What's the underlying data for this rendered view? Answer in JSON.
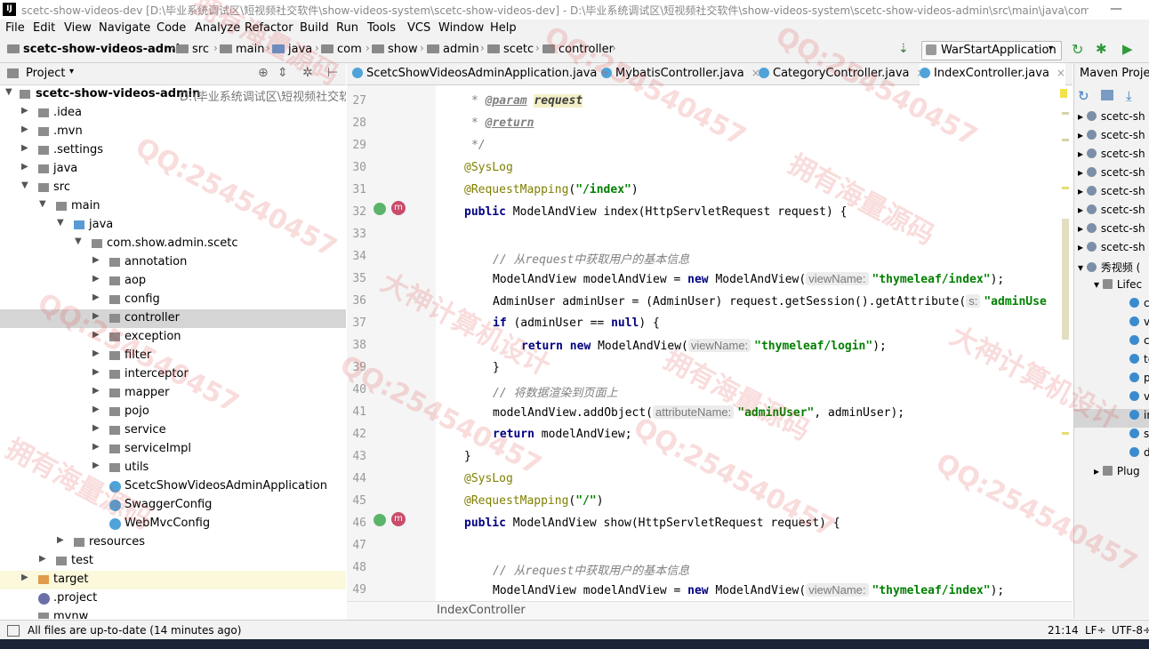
{
  "window": {
    "title": "scetc-show-videos-dev [D:\\毕业系统调试区\\短视频社交软件\\show-videos-system\\scetc-show-videos-dev] - D:\\毕业系统调试区\\短视频社交软件\\show-videos-system\\scetc-show-videos-admin\\src\\main\\java\\com\\...",
    "logo": "IJ",
    "minimize": "—"
  },
  "menu": [
    "File",
    "Edit",
    "View",
    "Navigate",
    "Code",
    "Analyze",
    "Refactor",
    "Build",
    "Run",
    "Tools",
    "VCS",
    "Window",
    "Help"
  ],
  "breadcrumbs": [
    "scetc-show-videos-admin",
    "src",
    "main",
    "java",
    "com",
    "show",
    "admin",
    "scetc",
    "controller"
  ],
  "run_config": "WarStartApplication",
  "project_panel": {
    "title": "Project",
    "tree": [
      {
        "label": "scetc-show-videos-admin",
        "path": "D:\\毕业系统调试区\\短视频社交软件"
      },
      {
        "label": ".idea"
      },
      {
        "label": ".mvn"
      },
      {
        "label": ".settings"
      },
      {
        "label": "java"
      },
      {
        "label": "src"
      },
      {
        "label": "main"
      },
      {
        "label": "java"
      },
      {
        "label": "com.show.admin.scetc"
      },
      {
        "label": "annotation"
      },
      {
        "label": "aop"
      },
      {
        "label": "config"
      },
      {
        "label": "controller"
      },
      {
        "label": "exception"
      },
      {
        "label": "filter"
      },
      {
        "label": "interceptor"
      },
      {
        "label": "mapper"
      },
      {
        "label": "pojo"
      },
      {
        "label": "service"
      },
      {
        "label": "serviceImpl"
      },
      {
        "label": "utils"
      },
      {
        "label": "ScetcShowVideosAdminApplication"
      },
      {
        "label": "SwaggerConfig"
      },
      {
        "label": "WebMvcConfig"
      },
      {
        "label": "resources"
      },
      {
        "label": "test"
      },
      {
        "label": "target"
      },
      {
        "label": ".project"
      },
      {
        "label": "mvnw"
      }
    ]
  },
  "editor": {
    "tabs": [
      {
        "label": "ScetcShowVideosAdminApplication.java",
        "active": false
      },
      {
        "label": "MybatisController.java",
        "active": false
      },
      {
        "label": "CategoryController.java",
        "active": false
      },
      {
        "label": "IndexController.java",
        "active": true
      }
    ],
    "line_numbers": [
      "27",
      "28",
      "29",
      "30",
      "31",
      "32",
      "33",
      "34",
      "35",
      "36",
      "37",
      "38",
      "39",
      "40",
      "41",
      "42",
      "43",
      "44",
      "45",
      "46",
      "47",
      "48",
      "49"
    ],
    "bottom_breadcrumb": "IndexController"
  },
  "code_tokens": {
    "star": "* ",
    "param_tag": "@param",
    "param_name": "request",
    "return_tag": "@return",
    "close_doc": "*/",
    "syslog": "@SysLog",
    "reqmap": "@RequestMapping",
    "path_index": "\"/index\"",
    "path_root": "\"/\"",
    "public": "public",
    "mav_type": " ModelAndView ",
    "m_index": "index(HttpServletRequest request) {",
    "m_show": "show(HttpServletRequest request) {",
    "comment_get_user": "// 从request中获取用户的基本信息",
    "mav_decl": "ModelAndView modelAndView = ",
    "new": "new",
    "mav_ctor": " ModelAndView(",
    "hint_viewname": "viewName:",
    "hint_s": "s:",
    "hint_attrname": "attributeName:",
    "str_index": "\"thymeleaf/index\"",
    "str_login": "\"thymeleaf/login\"",
    "str_admin_user": "\"adminUser\"",
    "str_admin_user_cut": "\"adminUse",
    "close_paren_semi": ");",
    "admin_decl": "AdminUser adminUser = (AdminUser) request.getSession().getAttribute(",
    "if": "if",
    "if_cond": " (adminUser == ",
    "null": "null",
    "if_tail": ") {",
    "return": "return",
    "close_brace": "}",
    "comment_render": "// 将数据渲染到页面上",
    "add_object": "modelAndView.addObject(",
    "add_object_tail": ", adminUser);",
    "return_mav": " modelAndView;",
    "rm_close": ")"
  },
  "maven_panel": {
    "title": "Maven Projects",
    "items": [
      "scetc-sh",
      "scetc-sh",
      "scetc-sh",
      "scetc-sh",
      "scetc-sh",
      "scetc-sh",
      "scetc-sh",
      "scetc-sh",
      "秀视频 (",
      "Lifec",
      "c",
      "v",
      "c",
      "te",
      "p",
      "v",
      "in",
      "s",
      "d",
      "Plug"
    ]
  },
  "status": {
    "message": "All files are up-to-date (14 minutes ago)",
    "position": "21:14",
    "line_sep": "LF÷",
    "encoding": "UTF-8÷"
  },
  "watermark": {
    "text_qq": "QQ:254540457",
    "text_cn1": "拥有海量源码",
    "text_cn2": "大神计算机设计"
  }
}
